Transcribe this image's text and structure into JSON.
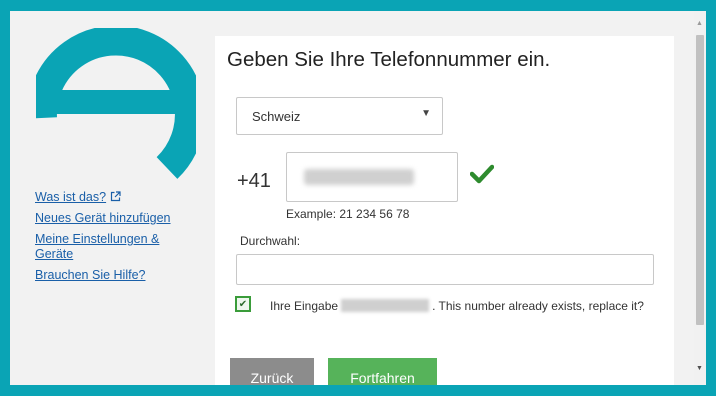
{
  "colors": {
    "brand": "#0aa4b5",
    "link": "#1a5fa8",
    "success": "#2e8b2e",
    "primary_button": "#56b35a",
    "secondary_button": "#8c8c8c"
  },
  "sidebar": {
    "logo_icon": "e-logo-icon",
    "links": [
      {
        "label": "Was ist das?",
        "icon": "external-link-icon"
      },
      {
        "label": "Neues Gerät hinzufügen"
      },
      {
        "label": "Meine Einstellungen & Geräte"
      },
      {
        "label": "Brauchen Sie Hilfe?"
      }
    ]
  },
  "main": {
    "title": "Geben Sie Ihre Telefonnummer ein.",
    "country_select": {
      "value": "Schweiz"
    },
    "phone": {
      "prefix": "+41",
      "example": "Example: 21 234 56 78",
      "valid_icon": "checkmark-icon"
    },
    "extension": {
      "label": "Durchwahl:",
      "value": ""
    },
    "replace_checkbox": {
      "checked": true,
      "text_before": "Ihre Eingabe",
      "text_after": ". This number already exists, replace it?"
    },
    "buttons": {
      "back": "Zurück",
      "continue": "Fortfahren"
    }
  }
}
